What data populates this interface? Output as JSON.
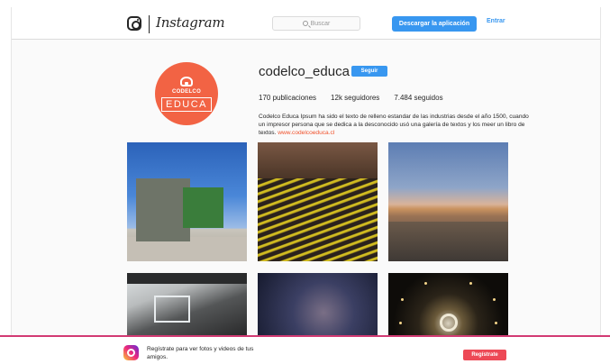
{
  "header": {
    "logo_icon": "instagram-camera-icon",
    "wordmark": "Instagram",
    "search_placeholder": "Buscar",
    "download_label": "Descargar la aplicación",
    "login_label": "Entrar",
    "accent": "#3897f0"
  },
  "profile": {
    "avatar_top": "CODELCO",
    "avatar_bottom": "EDUCA",
    "avatar_color": "#f26344",
    "username": "codelco_educa",
    "follow_label": "Seguir",
    "stats": {
      "posts": "170 publicaciones",
      "followers": "12k seguidores",
      "following": "7.484 seguidos"
    },
    "bio": "Codelco Educa Ipsum ha sido el texto de relleno estandar de las industrias desde el año 1500, cuando un impresor  persona que se dedica a la desconocido usó una galería de textos y los meer un libro de textos.",
    "link": "www.codelcoeduca.cl"
  },
  "grid": {
    "items": [
      {
        "icon": "industrial-silo-photo"
      },
      {
        "icon": "smelter-rails-photo"
      },
      {
        "icon": "desert-landscape-photo"
      },
      {
        "icon": "truck-cabin-photo"
      },
      {
        "icon": "machinery-photo"
      },
      {
        "icon": "tunnel-photo"
      }
    ]
  },
  "banner": {
    "text": "Regístrate para ver fotos y videos de tus amigos.",
    "signup_label": "Regístrate",
    "signup_color": "#ed4956",
    "border_color": "#d23a73"
  }
}
